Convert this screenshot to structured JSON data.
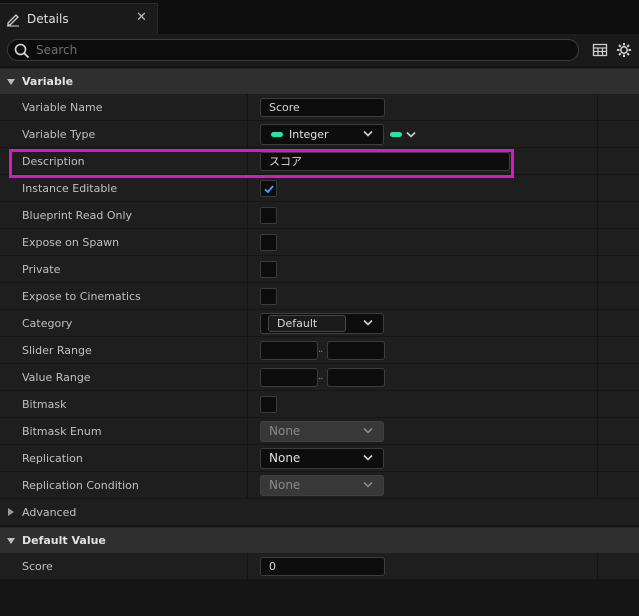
{
  "tab": {
    "title": "Details",
    "close_glyph": "✕",
    "icon": "edit-pencil-icon"
  },
  "search": {
    "placeholder": "Search",
    "value": ""
  },
  "toolbar": {
    "icons": [
      "table-view-icon",
      "settings-gear-icon"
    ]
  },
  "sections": {
    "variable": {
      "label": "Variable",
      "expanded": true
    },
    "advanced": {
      "label": "Advanced",
      "expanded": false
    },
    "default_value": {
      "label": "Default Value",
      "expanded": true
    }
  },
  "rows": {
    "variable_name": {
      "label": "Variable Name",
      "value": "Score"
    },
    "variable_type": {
      "label": "Variable Type",
      "value": "Integer",
      "pin_color": "#2ee0a8"
    },
    "description": {
      "label": "Description",
      "value": "スコア",
      "highlighted": true,
      "highlight_color": "#d21ac5"
    },
    "instance_editable": {
      "label": "Instance Editable",
      "checked": true
    },
    "blueprint_read_only": {
      "label": "Blueprint Read Only",
      "checked": false
    },
    "expose_on_spawn": {
      "label": "Expose on Spawn",
      "checked": false
    },
    "private": {
      "label": "Private",
      "checked": false
    },
    "expose_to_cinematics": {
      "label": "Expose to Cinematics",
      "checked": false
    },
    "category": {
      "label": "Category",
      "value": "Default"
    },
    "slider_range": {
      "label": "Slider Range",
      "min": "",
      "max": "",
      "separator": ".."
    },
    "value_range": {
      "label": "Value Range",
      "min": "",
      "max": "",
      "separator": ".."
    },
    "bitmask": {
      "label": "Bitmask",
      "checked": false
    },
    "bitmask_enum": {
      "label": "Bitmask Enum",
      "value": "None",
      "enabled": false
    },
    "replication": {
      "label": "Replication",
      "value": "None",
      "enabled": true
    },
    "replication_condition": {
      "label": "Replication Condition",
      "value": "None",
      "enabled": false
    },
    "score": {
      "label": "Score",
      "value": "0"
    }
  },
  "colors": {
    "check_blue": "#4aa0ff",
    "panel_bg": "#1e1e1e",
    "section_bg": "#2f2f2f"
  }
}
